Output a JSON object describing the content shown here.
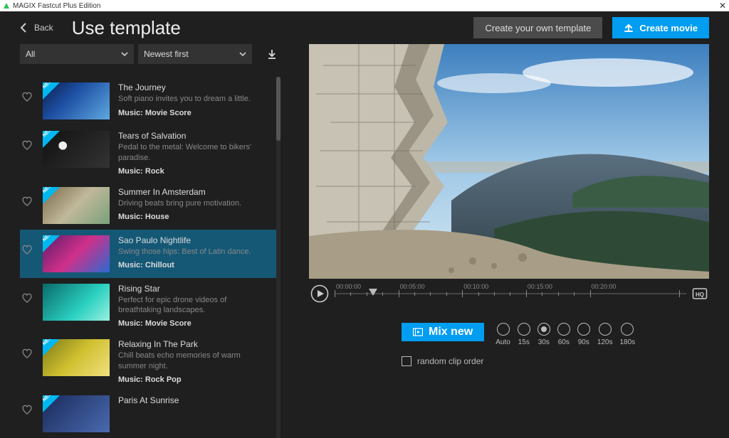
{
  "window": {
    "app_title": "MAGIX Fastcut Plus Edition"
  },
  "header": {
    "back_label": "Back",
    "page_title": "Use template",
    "own_template_label": "Create your own template",
    "create_movie_label": "Create movie"
  },
  "filters": {
    "category_value": "All",
    "sort_value": "Newest first"
  },
  "templates": [
    {
      "title": "The Journey",
      "desc": "Soft piano invites you to dream a little.",
      "music": "Music: Movie Score",
      "new": true
    },
    {
      "title": "Tears of Salvation",
      "desc": "Pedal to the metal: Welcome to bikers' paradise.",
      "music": "Music: Rock",
      "new": true
    },
    {
      "title": "Summer In Amsterdam",
      "desc": "Driving beats bring pure motivation.",
      "music": "Music: House",
      "new": true
    },
    {
      "title": "Sao Paulo Nightlife",
      "desc": "Swing those hips: Best of Latin dance.",
      "music": "Music: Chillout",
      "new": true
    },
    {
      "title": "Rising Star",
      "desc": "Perfect for epic drone videos of breathtaking landscapes.",
      "music": "Music: Movie Score",
      "new": false
    },
    {
      "title": "Relaxing In The Park",
      "desc": "Chill beats echo memories of warm summer night.",
      "music": "Music: Rock Pop",
      "new": true
    },
    {
      "title": "Paris At Sunrise",
      "desc": "",
      "music": "",
      "new": true
    }
  ],
  "selected_template_index": 3,
  "badge_text": "NEW",
  "timeline": {
    "ticks": [
      "00:00:00",
      "00:05:00",
      "00:10:00",
      "00:15:00",
      "00:20:00"
    ],
    "playhead_position_pct": 11
  },
  "mix": {
    "mix_label": "Mix new",
    "durations": [
      "Auto",
      "15s",
      "30s",
      "60s",
      "90s",
      "120s",
      "180s"
    ],
    "selected_duration_index": 2,
    "random_label": "random clip order",
    "random_checked": false
  }
}
